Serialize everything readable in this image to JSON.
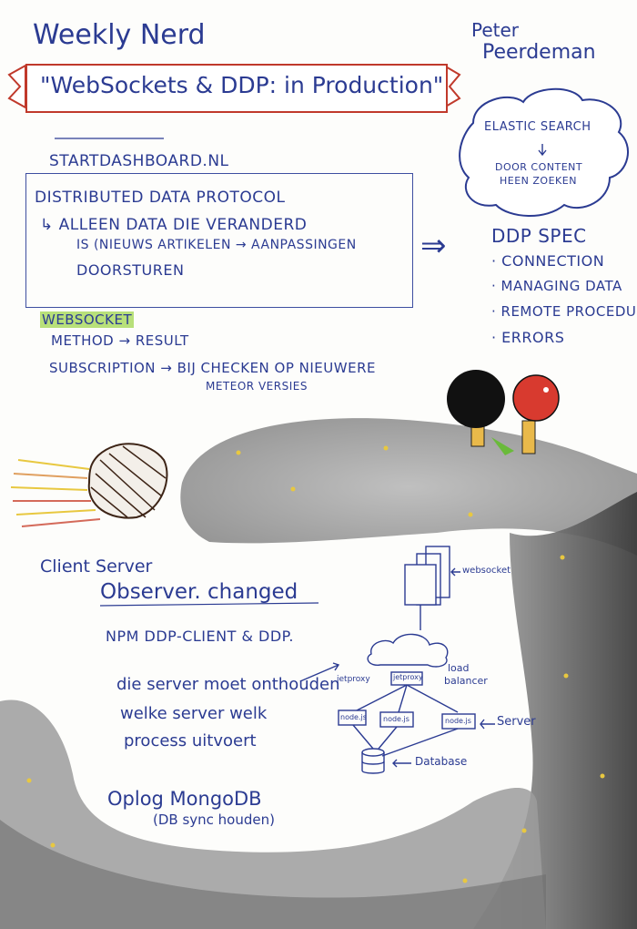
{
  "header": {
    "title": "Weekly Nerd",
    "author_first": "Peter",
    "author_last": "Peerdeman",
    "banner": "\"WebSockets & DDP: in Production\""
  },
  "elastic": {
    "line1": "ELASTIC SEARCH",
    "line2": "DOOR CONTENT",
    "line3": "HEEN ZOEKEN"
  },
  "site": "STARTDASHBOARD.NL",
  "ddp_box": {
    "heading": "DISTRIBUTED DATA PROTOCOL",
    "line1": "↳ ALLEEN DATA DIE VERANDERD",
    "line2": "IS (NIEUWS ARTIKELEN → AANPASSINGEN",
    "line3": "DOORSTUREN"
  },
  "arrow": "⇒",
  "ddp_spec": {
    "title": "DDP SPEC",
    "items": [
      "· CONNECTION",
      "· MANAGING DATA",
      "· REMOTE PROCEDURE",
      "· ERRORS"
    ]
  },
  "websocket": {
    "label": "WEBSOCKET",
    "method": "METHOD → RESULT",
    "subscription": "SUBSCRIPTION → BIJ CHECKEN OP NIEUWERE",
    "subscription2": "METEOR VERSIES"
  },
  "client_server": {
    "title": "Client Server",
    "observer": "Observer. changed",
    "npm": "NPM   DDP-CLIENT & DDP.",
    "note1": "die server moet onthouden",
    "note2": "welke server welk",
    "note3": "process uitvoert",
    "oplog1": "Oplog MongoDB",
    "oplog2": "(DB sync houden)"
  },
  "diagram": {
    "websocket": "websocket",
    "load_balancer1": "load",
    "load_balancer2": "balancer",
    "server": "Server",
    "database": "Database",
    "proxy_left": "jetproxy",
    "proxy_right": "jetproxy",
    "node": "node.js"
  },
  "colors": {
    "ink": "#2b3b92",
    "banner": "#c0392b",
    "highlight_green": "#b8e07a",
    "paint": "#8f8f8f",
    "paddle_red": "#d83a2f",
    "paddle_black": "#111111"
  }
}
